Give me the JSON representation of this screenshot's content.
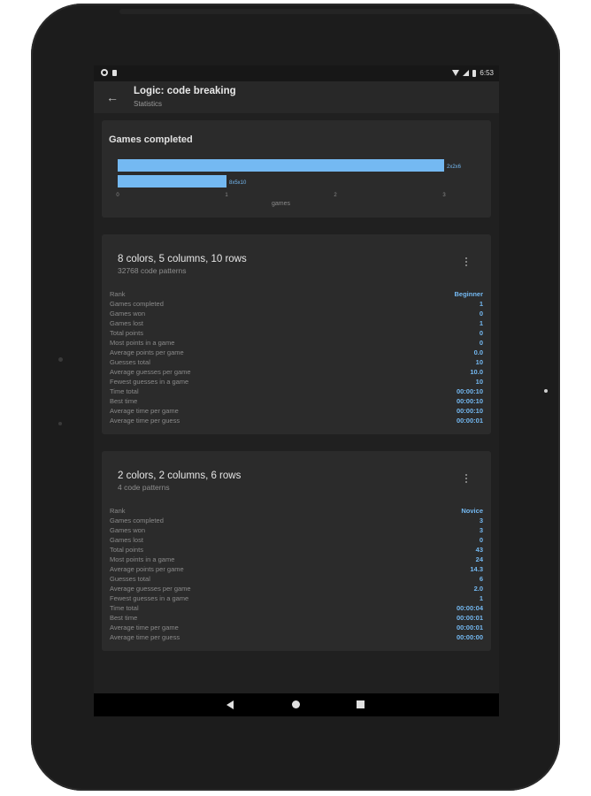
{
  "status_bar": {
    "time": "6:53"
  },
  "app_bar": {
    "title": "Logic: code breaking",
    "subtitle": "Statistics"
  },
  "chart_card": {
    "title": "Games completed"
  },
  "chart_data": {
    "type": "bar",
    "orientation": "horizontal",
    "categories": [
      "2x2x6",
      "8x5x10"
    ],
    "values": [
      3,
      1
    ],
    "xlabel": "games",
    "ylabel": "",
    "xlim": [
      0,
      3
    ],
    "xticks": [
      "0",
      "1",
      "2",
      "3"
    ],
    "bar_color": "#74b9f2"
  },
  "stat_labels": [
    "Rank",
    "Games completed",
    "Games won",
    "Games lost",
    "Total points",
    "Most points in a game",
    "Average points per game",
    "Guesses total",
    "Average guesses per game",
    "Fewest guesses in a game",
    "Time total",
    "Best time",
    "Average time per game",
    "Average time per guess"
  ],
  "cards": [
    {
      "title": "8 colors, 5 columns, 10 rows",
      "subtitle": "32768 code patterns",
      "values": [
        "Beginner",
        "1",
        "0",
        "1",
        "0",
        "0",
        "0.0",
        "10",
        "10.0",
        "10",
        "00:00:10",
        "00:00:10",
        "00:00:10",
        "00:00:01"
      ]
    },
    {
      "title": "2 colors, 2 columns, 6 rows",
      "subtitle": "4 code patterns",
      "values": [
        "Novice",
        "3",
        "3",
        "0",
        "43",
        "24",
        "14.3",
        "6",
        "2.0",
        "1",
        "00:00:04",
        "00:00:01",
        "00:00:01",
        "00:00:00"
      ]
    }
  ],
  "colors": {
    "accent": "#74b9f2",
    "background": "#202020",
    "card": "#2b2b2b"
  }
}
